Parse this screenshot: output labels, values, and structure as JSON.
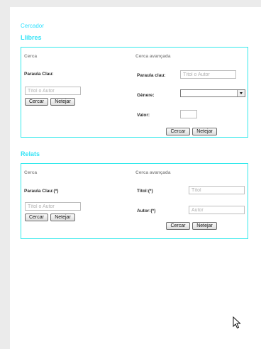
{
  "site": {
    "title": "Cercador"
  },
  "libres": {
    "title": "Llibres",
    "cerca": {
      "heading": "Cerca",
      "keyword_label": "Paraula Clau:",
      "keyword_placeholder": "Títol o Autor",
      "search_label": "Cercar",
      "clear_label": "Netejar"
    },
    "avancada": {
      "heading": "Cerca avançada",
      "keyword_label": "Paraula clau:",
      "keyword_placeholder": "Títol o Autor",
      "genre_label": "Gènere:",
      "genre_value": "",
      "value_label": "Valor:",
      "search_label": "Cercar",
      "clear_label": "Netejar"
    }
  },
  "relats": {
    "title": "Relats",
    "cerca": {
      "heading": "Cerca",
      "keyword_label": "Paraula Clau:(*)",
      "keyword_placeholder": "Títol o Autor",
      "search_label": "Cercar",
      "clear_label": "Netejar"
    },
    "avancada": {
      "heading": "Cerca avançada",
      "title_label": "Títol:(*)",
      "title_placeholder": "Títol",
      "author_label": "Autor:(*)",
      "author_placeholder": "Autor",
      "search_label": "Cercar",
      "clear_label": "Netejar"
    }
  },
  "colors": {
    "accent": "#2fe0ff",
    "panel_border": "#34e9ec"
  }
}
